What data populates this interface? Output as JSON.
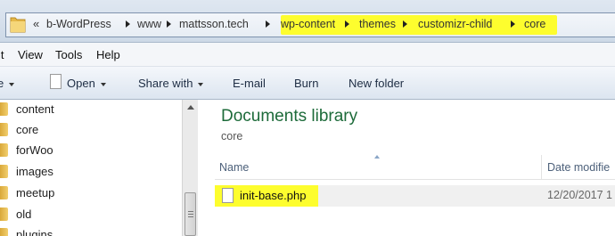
{
  "address_bar": {
    "overflow_chevron": "«",
    "breadcrumbs": [
      "b-WordPress",
      "www",
      "mattsson.tech",
      "wp-content",
      "themes",
      "customizr-child",
      "core"
    ],
    "highlight_color": "#fdfd2e"
  },
  "menu": {
    "items": [
      "it",
      "View",
      "Tools",
      "Help"
    ]
  },
  "toolbar": {
    "organize_partial": "e",
    "open_label": "Open",
    "share_label": "Share with",
    "email_label": "E-mail",
    "burn_label": "Burn",
    "new_folder_label": "New folder"
  },
  "nav_pane": {
    "items": [
      "content",
      "core",
      "forWoo",
      "images",
      "meetup",
      "old",
      "plugins"
    ]
  },
  "content": {
    "library_title": "Documents library",
    "library_subtitle": "core",
    "columns": {
      "name": "Name",
      "date": "Date modifie"
    },
    "files": [
      {
        "name": "init-base.php",
        "date": "12/20/2017 1"
      }
    ],
    "title_color": "#1d6b3a"
  }
}
